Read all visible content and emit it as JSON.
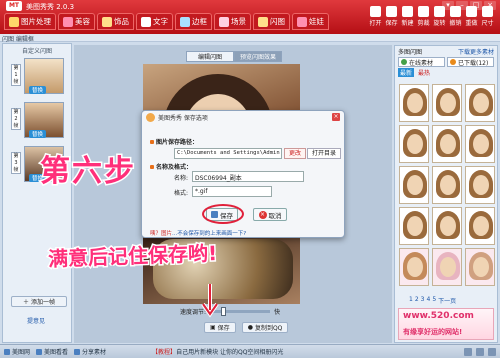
{
  "window": {
    "title": "美图秀秀 2.0.3",
    "logo_text": "MT"
  },
  "main_tabs": [
    {
      "label": "图片处理",
      "icon": "picture-icon"
    },
    {
      "label": "美容",
      "icon": "heart-icon"
    },
    {
      "label": "饰品",
      "icon": "star-icon"
    },
    {
      "label": "文字",
      "icon": "text-icon"
    },
    {
      "label": "边框",
      "icon": "frame-icon"
    },
    {
      "label": "场景",
      "icon": "scene-icon"
    },
    {
      "label": "闪图",
      "icon": "flash-icon"
    },
    {
      "label": "娃娃",
      "icon": "doll-icon"
    }
  ],
  "toolbar": [
    "打开",
    "保存",
    "新建",
    "剪裁",
    "旋转",
    "撤销",
    "重做",
    "尺寸"
  ],
  "subbar": {
    "label": "闪图 编辑框"
  },
  "left_panel": {
    "title": "自定义闪图",
    "frames": [
      {
        "num": "第1帧",
        "replace": "替换"
      },
      {
        "num": "第2帧",
        "replace": "替换"
      },
      {
        "num": "第3帧",
        "replace": "替换"
      }
    ],
    "add_frame": "添加一帧",
    "feedback": "提意见"
  },
  "center": {
    "tabs": [
      "编辑闪图",
      "预览闪图效果"
    ],
    "speed_label": "速度调节:",
    "speed_fast": "快",
    "speed_value": 0.2,
    "save_button": "保存",
    "copy_button": "复制到QQ"
  },
  "dialog": {
    "title": "美图秀秀  保存选项",
    "path_label": "图片保存路径：",
    "path_value": "C:\\Documents and Settings\\Admin",
    "browse": "更改",
    "open_dir": "打开目录",
    "name_section": "名称及格式：",
    "name_label": "名称:",
    "name_value": "DSC06994_副本",
    "format_label": "格式:",
    "format_value": "*.gif",
    "save": "保存",
    "cancel": "取消",
    "tip_prefix": "咦？图片",
    "tip_question": "...不会保存到的上来画面一下?"
  },
  "overlay": {
    "step": "第六步",
    "note": "满意后记住保存哟!"
  },
  "right_panel": {
    "head_left": "多图闪图",
    "head_right": "下载更多素材",
    "tab_online": "在线素材",
    "tab_downloaded": "已下载(12)",
    "filter_chip": "最新",
    "filter_hot": "最热",
    "pager": [
      "1",
      "2",
      "3",
      "4",
      "5",
      "下一页"
    ],
    "ad_url": "www.520.com",
    "ad_slogan": "有缘享好运的网站!"
  },
  "statusbar": {
    "items": [
      "美图网",
      "美图看看",
      "分享素材"
    ],
    "message_hl": "【教程】",
    "message": "自己用片新模块 让你的QQ空间相册闪光"
  }
}
